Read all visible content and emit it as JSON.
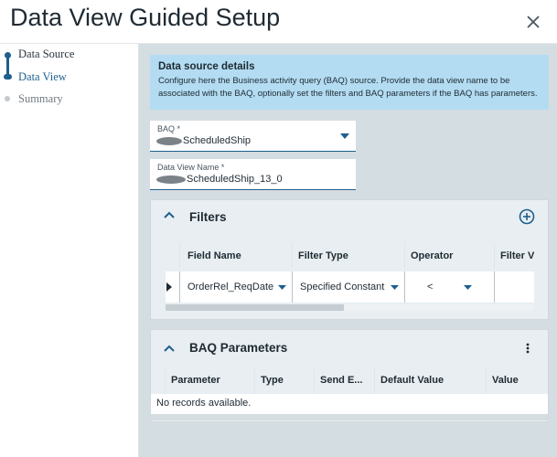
{
  "dialog": {
    "title": "Data View Guided Setup",
    "close_icon": "close-icon"
  },
  "steps": [
    {
      "label": "Data Source",
      "state": "done"
    },
    {
      "label": "Data View",
      "state": "current"
    },
    {
      "label": "Summary",
      "state": "todo"
    }
  ],
  "info": {
    "title": "Data source details",
    "text": "Configure here the Business activity query (BAQ) source. Provide the data view name to be associated with the BAQ, optionally set the filters and BAQ parameters if the BAQ has parameters."
  },
  "baq_field": {
    "label": "BAQ *",
    "value": "ScheduledShip"
  },
  "dataview_field": {
    "label": "Data View Name *",
    "value": "ScheduledShip_13_0"
  },
  "filters": {
    "title": "Filters",
    "columns": [
      "Field Name",
      "Filter Type",
      "Operator",
      "Filter V"
    ],
    "rows": [
      {
        "field_name": "OrderRel_ReqDate",
        "filter_type": "Specified Constant",
        "operator": "<",
        "filter_value": ""
      }
    ]
  },
  "baq_parameters": {
    "title": "BAQ Parameters",
    "columns": [
      "Parameter",
      "Type",
      "Send E...",
      "Default Value",
      "Value"
    ],
    "empty_text": "No records available."
  },
  "colors": {
    "accent": "#1e5f8e",
    "info_bg": "#b3dcf2",
    "main_bg": "#d4dde2"
  }
}
